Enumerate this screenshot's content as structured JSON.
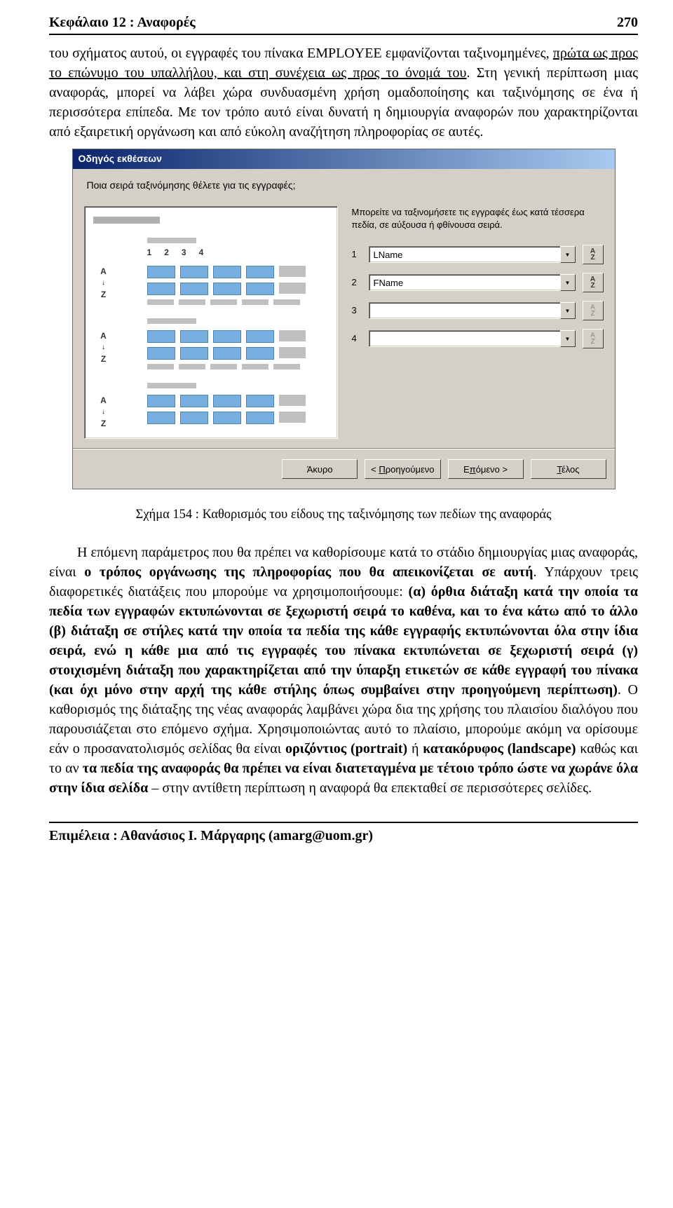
{
  "header": {
    "title": "Κεφάλαιο 12 : Αναφορές",
    "page_no": "270"
  },
  "para1_pre": "του σχήματος αυτού, οι εγγραφές του πίνακα EMPLOYEE εμφανίζονται ταξινομη­μένες, ",
  "para1_u1": "πρώτα ως προς το επώνυμο του υπαλλήλου, και στη συνέχεια ως προς το όνομά του",
  "para1_post1": ". Στη γενική περίπτωση μιας αναφοράς, μπορεί να λάβει χώρα συνδυα­σμένη χρήση ομαδοποίησης και ταξινόμησης σε ένα ή περισσότερα επίπεδα. Με τον τρόπο αυτό είναι δυνατή η δημιουργία αναφορών που χαρακτηρίζονται από εξαι­ρετική οργάνωση και από εύκολη αναζήτηση πληροφορίας σε αυτές.",
  "wizard": {
    "title": "Οδηγός εκθέσεων",
    "question": "Ποια σειρά ταξινόμησης θέλετε για τις εγγραφές;",
    "instructions": "Μπορείτε να ταξινομήσετε τις εγγραφές έως κατά τέσσερα πεδία, σε αύξουσα ή φθίνουσα σειρά.",
    "preview_cols": [
      "1",
      "2",
      "3",
      "4"
    ],
    "rows": [
      {
        "n": "1",
        "value": "LName"
      },
      {
        "n": "2",
        "value": "FName"
      },
      {
        "n": "3",
        "value": ""
      },
      {
        "n": "4",
        "value": ""
      }
    ],
    "az_label": "A↓Z",
    "buttons": {
      "cancel": "Άκυρο",
      "back_u": "Π",
      "back": "ροηγούμενο",
      "next_pre": "Ε",
      "next_u": "π",
      "next_post": "όμενο >",
      "finish_u": "Τ",
      "finish": "έλος"
    }
  },
  "caption": "Σχήμα 154 : Καθορισμός του είδους της ταξινόμησης των πεδίων της αναφοράς",
  "para2_pre": "Η επόμενη παράμετρος που θα πρέπει να καθορίσουμε κατά το στάδιο δη­μιουργίας μιας αναφοράς, είναι ",
  "para2_b1": "ο τρόπος οργάνωσης της πληροφορίας που θα απεικονίζεται σε αυτή",
  "para2_mid1": ". Υπάρχουν τρεις διαφορετικές διατάξεις που μπορούμε να χρησιμοποιήσουμε: ",
  "para2_b2": "(α) όρθια διάταξη κατά την οποία τα πεδία των εγγραφών εκτυπώνονται σε ξεχωριστή σειρά το καθένα, και το ένα κάτω από το άλλο (β) διάταξη σε στήλες κατά την οποία τα πεδία της κάθε εγγραφής εκτυπώνονται όλα στην ίδια σειρά, ενώ η κάθε μια από τις εγγραφές του πίνακα εκτυπώνεται σε ξεχωριστή σειρά (γ) στοιχισμένη διάταξη που χαρακτηρίζεται από την ύπαρξη ετικετών σε κάθε εγγραφή του πίνακα (και όχι μόνο στην αρχή της κάθε στήλης όπως συμβαίνει στην προηγούμενη περίπτωση)",
  "para2_mid2": ". Ο καθορισμός της διάταξης της νέας αναφοράς λαμβάνει χώρα δια της χρήσης του πλαισίου διαλόγου που παρουσιά­ζεται στο επόμενο σχήμα. Χρησιμοποιώντας αυτό το πλαίσιο, μπορούμε ακόμη να ορίσουμε εάν ο προσανατολισμός σελίδας θα είναι ",
  "para2_b3": "οριζόντιος (portrait)",
  "para2_mid3": " ή ",
  "para2_b4": "κατακό­ρυφος (landscape)",
  "para2_mid4": " καθώς και το αν ",
  "para2_b5": "τα πεδία της αναφοράς θα πρέπει να είναι δια­τεταγμένα με τέτοιο τρόπο ώστε να χωράνε όλα στην ίδια σελίδα",
  "para2_post": " – στην αντίθετη περίπτωση η αναφορά θα επεκταθεί σε περισσότερες σελίδες.",
  "footer": "Επιμέλεια : Αθανάσιος Ι. Μάργαρης (amarg@uom.gr)"
}
